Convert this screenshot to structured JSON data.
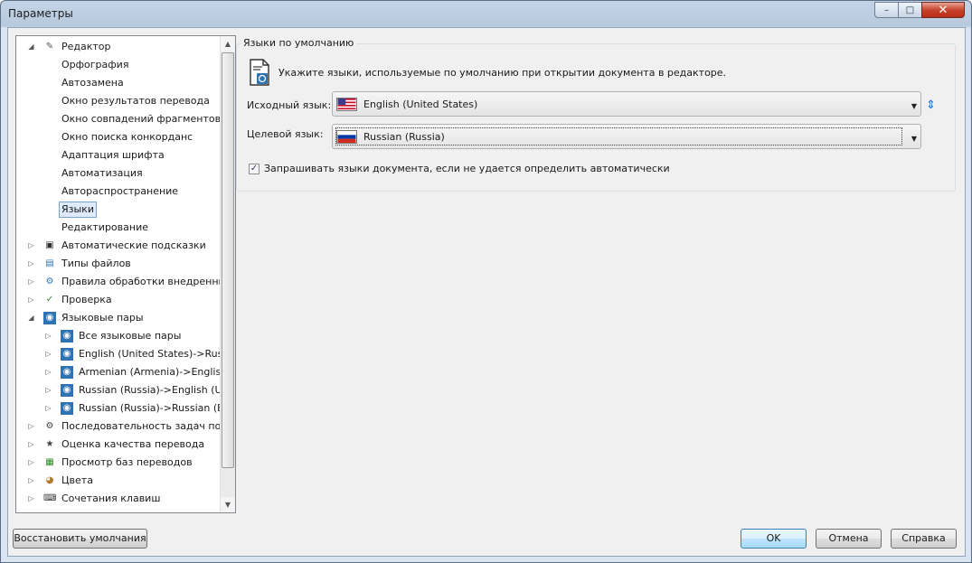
{
  "window": {
    "title": "Параметры",
    "close_glyph": "✕",
    "max_glyph": "□",
    "min_glyph": "–"
  },
  "tree": {
    "scroll_up": "▲",
    "scroll_down": "▼",
    "items": [
      {
        "label": "Редактор",
        "level": 0,
        "expander": "◢",
        "icon": "pencil-icon"
      },
      {
        "label": "Орфография",
        "level": 1
      },
      {
        "label": "Автозамена",
        "level": 1
      },
      {
        "label": "Окно результатов перевода",
        "level": 1
      },
      {
        "label": "Окно совпадений фрагментов",
        "level": 1
      },
      {
        "label": "Окно поиска конкорданс",
        "level": 1
      },
      {
        "label": "Адаптация шрифта",
        "level": 1
      },
      {
        "label": "Автоматизация",
        "level": 1
      },
      {
        "label": "Автораспространение",
        "level": 1
      },
      {
        "label": "Языки",
        "level": 1,
        "selected": true
      },
      {
        "label": "Редактирование",
        "level": 1
      },
      {
        "label": "Автоматические подсказки",
        "level": 0,
        "expander": "▷",
        "icon": "autosuggest-icon"
      },
      {
        "label": "Типы файлов",
        "level": 0,
        "expander": "▷",
        "icon": "file-types-icon"
      },
      {
        "label": "Правила обработки внедренных",
        "level": 0,
        "expander": "▷",
        "icon": "embedded-rules-icon"
      },
      {
        "label": "Проверка",
        "level": 0,
        "expander": "▷",
        "icon": "verification-icon"
      },
      {
        "label": "Языковые пары",
        "level": 0,
        "expander": "◢",
        "icon": "language-pair-icon"
      },
      {
        "label": "Все языковые пары",
        "level": 1,
        "expander": "▷",
        "icon": "language-pair-icon"
      },
      {
        "label": "English (United States)->Russia",
        "level": 1,
        "expander": "▷",
        "icon": "language-pair-icon"
      },
      {
        "label": "Armenian (Armenia)->English (",
        "level": 1,
        "expander": "▷",
        "icon": "language-pair-icon"
      },
      {
        "label": "Russian (Russia)->English (Unit",
        "level": 1,
        "expander": "▷",
        "icon": "language-pair-icon"
      },
      {
        "label": "Russian (Russia)->Russian (Bel",
        "level": 1,
        "expander": "▷",
        "icon": "language-pair-icon"
      },
      {
        "label": "Последовательность задач по ум",
        "level": 0,
        "expander": "▷",
        "icon": "task-sequence-icon"
      },
      {
        "label": "Оценка качества перевода",
        "level": 0,
        "expander": "▷",
        "icon": "quality-icon"
      },
      {
        "label": "Просмотр баз переводов",
        "level": 0,
        "expander": "▷",
        "icon": "tm-viewer-icon"
      },
      {
        "label": "Цвета",
        "level": 0,
        "expander": "▷",
        "icon": "palette-icon"
      },
      {
        "label": "Сочетания клавиш",
        "level": 0,
        "expander": "▷",
        "icon": "keyboard-icon"
      }
    ]
  },
  "languages": {
    "group_title": "Языки по умолчанию",
    "info_text": "Укажите языки, используемые по умолчанию при открытии документа в редакторе.",
    "source_label": "Исходный язык:",
    "source_value": "English (United States)",
    "target_label": "Целевой язык:",
    "target_value": "Russian (Russia)",
    "dropdown_glyph": "▼",
    "swap_glyph": "⇕",
    "ask_checkbox_label": "Запрашивать языки документа, если не удается определить автоматически",
    "ask_checked": true,
    "check_glyph": "✓"
  },
  "buttons": {
    "restore_defaults": "Восстановить умолчания",
    "ok": "OK",
    "cancel": "Отмена",
    "help": "Справка"
  },
  "colors": {
    "selection": "#dceafb",
    "accent": "#2b6cc4"
  }
}
